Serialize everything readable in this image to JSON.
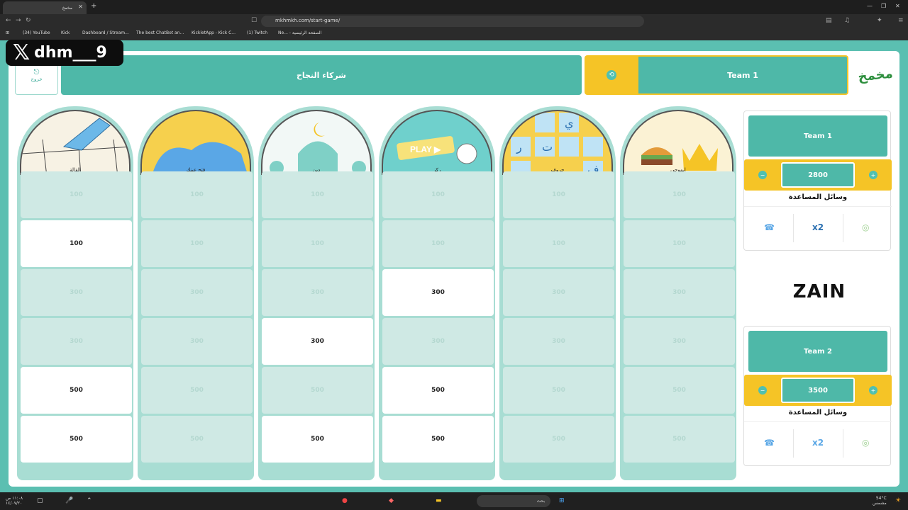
{
  "browser": {
    "tab_title": "مخمخ",
    "url": "mkhmkh.com/start-game/",
    "bookmarks": [
      "(34) YouTube",
      "Kick",
      "Dashboard / Stream...",
      "The best ChatBot an...",
      "KickletApp - Kick C...",
      "(1) Twitch",
      "Ne... - الصفحة الرئيسية"
    ]
  },
  "overlay": {
    "handle": "dhm___9"
  },
  "header": {
    "exit_label": "خروج",
    "partners": "شركاء النجاح",
    "turn_team": "Team 1",
    "logo": "مخمخ"
  },
  "categories": [
    {
      "name": "القالة",
      "cells": [
        100,
        100,
        300,
        300,
        500,
        500
      ],
      "available": [
        false,
        true,
        false,
        false,
        true,
        true
      ]
    },
    {
      "name": "فتح عينك",
      "cells": [
        100,
        100,
        300,
        300,
        500,
        500
      ],
      "available": [
        false,
        false,
        false,
        false,
        false,
        false
      ]
    },
    {
      "name": "دين",
      "cells": [
        100,
        100,
        300,
        300,
        500,
        500
      ],
      "available": [
        false,
        false,
        false,
        true,
        false,
        true
      ]
    },
    {
      "name": "ركز",
      "cells": [
        100,
        100,
        300,
        300,
        500,
        500
      ],
      "available": [
        false,
        false,
        true,
        false,
        true,
        true
      ]
    },
    {
      "name": "حروف",
      "cells": [
        100,
        100,
        300,
        300,
        500,
        500
      ],
      "available": [
        false,
        false,
        false,
        false,
        false,
        false
      ]
    },
    {
      "name": "ايموجي",
      "cells": [
        100,
        100,
        300,
        300,
        500,
        500
      ],
      "available": [
        false,
        false,
        false,
        false,
        false,
        false
      ]
    }
  ],
  "teams": [
    {
      "name": "Team 1",
      "score": "2800",
      "aids_title": "وسائل المساعدة",
      "aids": [
        "x2"
      ]
    },
    {
      "name": "Team 2",
      "score": "3500",
      "aids_title": "وسائل المساعدة",
      "aids": [
        "x2"
      ]
    }
  ],
  "sponsor": "ZAIN",
  "taskbar": {
    "search": "بحث",
    "weather": "54°C",
    "weather_desc": "مشمس",
    "time": "١١:٠٨ ص",
    "date": "١٤/٠٧/٢٠"
  },
  "colors": {
    "teal": "#4eb8a8",
    "yellow": "#f5c426",
    "page_bg": "#5bbfb1",
    "cell_used": "#cfe9e4"
  }
}
